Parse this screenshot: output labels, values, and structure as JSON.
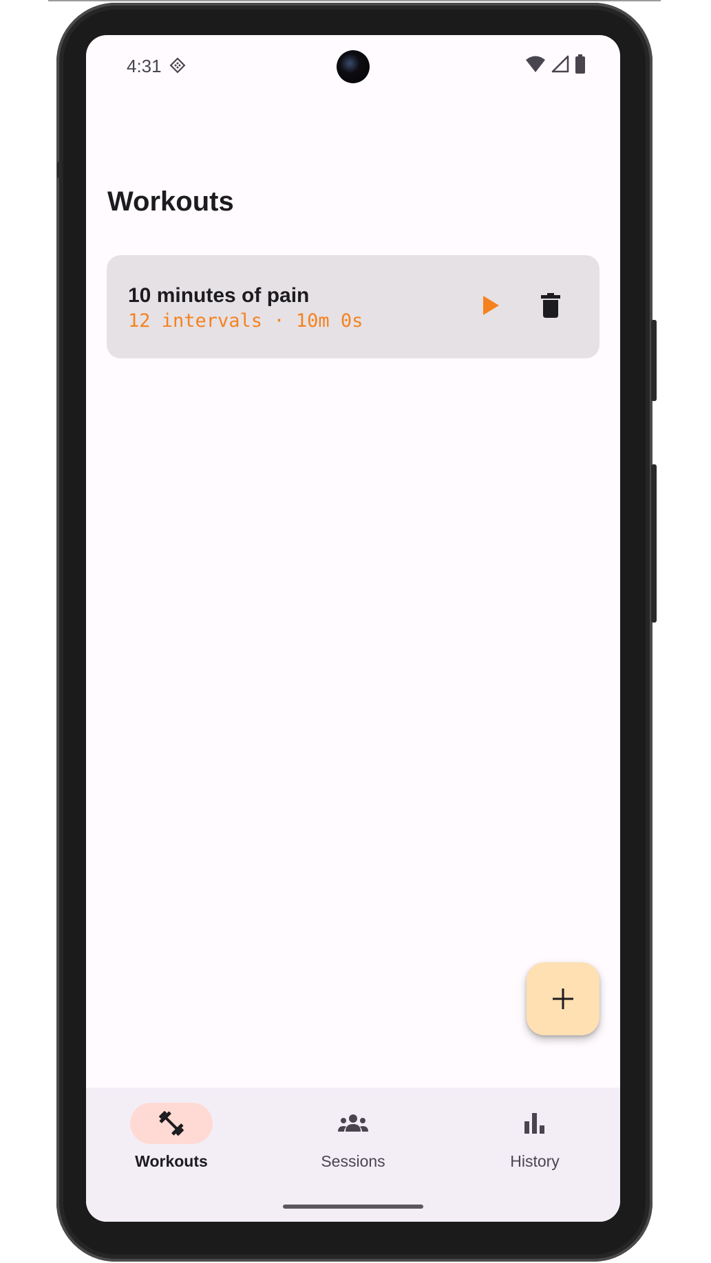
{
  "status_bar": {
    "time": "4:31",
    "icons": [
      "diamond-notification-icon",
      "wifi-icon",
      "cell-signal-icon",
      "battery-icon"
    ]
  },
  "screen": {
    "title": "Workouts"
  },
  "workouts": [
    {
      "name": "10 minutes of pain",
      "meta": "12 intervals · 10m 0s",
      "actions": [
        "play-icon",
        "trash-icon"
      ]
    }
  ],
  "fab": {
    "icon": "plus-icon"
  },
  "bottom_nav": {
    "items": [
      {
        "label": "Workouts",
        "icon": "dumbbell-icon",
        "active": true
      },
      {
        "label": "Sessions",
        "icon": "group-icon",
        "active": false
      },
      {
        "label": "History",
        "icon": "bar-chart-icon",
        "active": false
      }
    ]
  },
  "colors": {
    "accent": "#f5821f",
    "background": "#fffbfe",
    "card": "#e6e1e5",
    "fab": "#ffe0b3",
    "nav_bar": "#f3eef6",
    "nav_active_pill": "#ffdad4",
    "text_primary": "#1c1b1f",
    "text_secondary": "#49454f"
  }
}
